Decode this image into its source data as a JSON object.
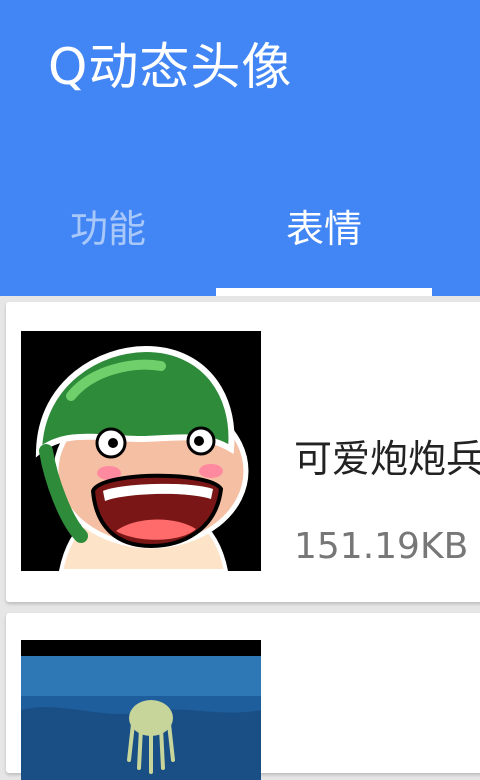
{
  "app": {
    "title": "Q动态头像"
  },
  "tabs": [
    {
      "label": "功能",
      "selected": false
    },
    {
      "label": "表情",
      "selected": true
    }
  ],
  "items": [
    {
      "title": "可爱炮炮兵",
      "size": "151.19KB",
      "thumb": "cartoon-soldier-green-helmet"
    },
    {
      "thumb": "underwater-jellyfish-scene"
    }
  ],
  "colors": {
    "primary": "#4285f4",
    "tab_inactive": "rgba(255,255,255,0.55)",
    "text_primary": "#222222",
    "text_secondary": "#777777"
  }
}
